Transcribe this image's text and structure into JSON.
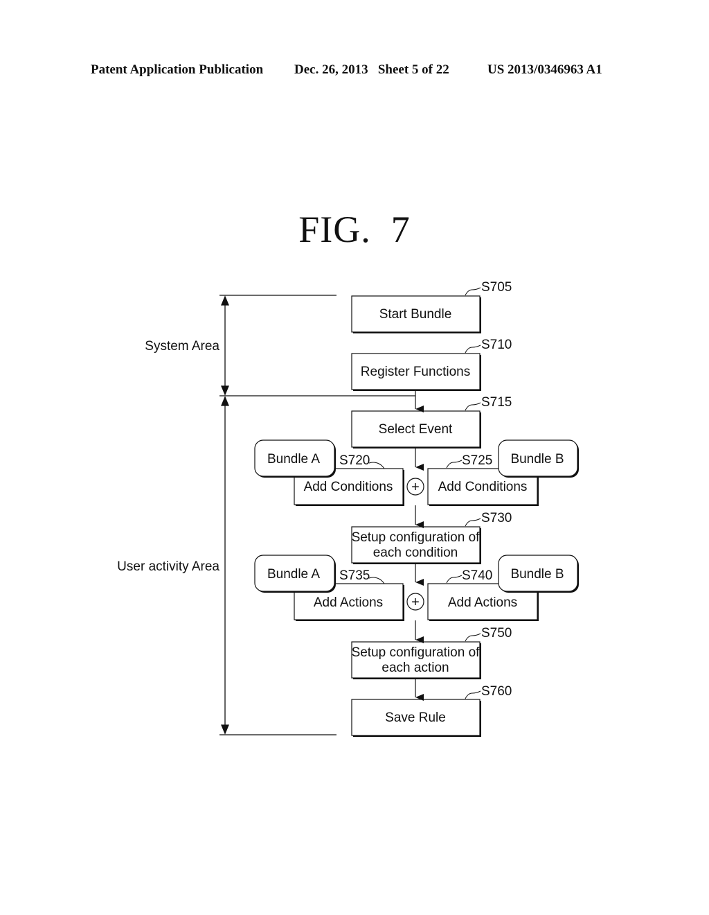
{
  "header": {
    "publication": "Patent Application Publication",
    "date_sheet": "Dec. 26, 2013   Sheet 5 of 22",
    "number": "US 2013/0346963 A1"
  },
  "figure": {
    "title": "FIG.  7"
  },
  "areas": {
    "system": "System Area",
    "user": "User activity Area"
  },
  "steps": {
    "s705": {
      "ref": "S705",
      "label": "Start Bundle"
    },
    "s710": {
      "ref": "S710",
      "label": "Register Functions"
    },
    "s715": {
      "ref": "S715",
      "label": "Select Event"
    },
    "s720": {
      "ref": "S720",
      "label": "Add Conditions",
      "bundle": "Bundle A"
    },
    "s725": {
      "ref": "S725",
      "label": "Add Conditions",
      "bundle": "Bundle B"
    },
    "s730": {
      "ref": "S730",
      "line1": "Setup configuration of",
      "line2": "each condition"
    },
    "s735": {
      "ref": "S735",
      "label": "Add Actions",
      "bundle": "Bundle A"
    },
    "s740": {
      "ref": "S740",
      "label": "Add Actions",
      "bundle": "Bundle B"
    },
    "s750": {
      "ref": "S750",
      "line1": "Setup configuration of",
      "line2": "each action"
    },
    "s760": {
      "ref": "S760",
      "label": "Save Rule"
    }
  },
  "combine_symbol": "+"
}
